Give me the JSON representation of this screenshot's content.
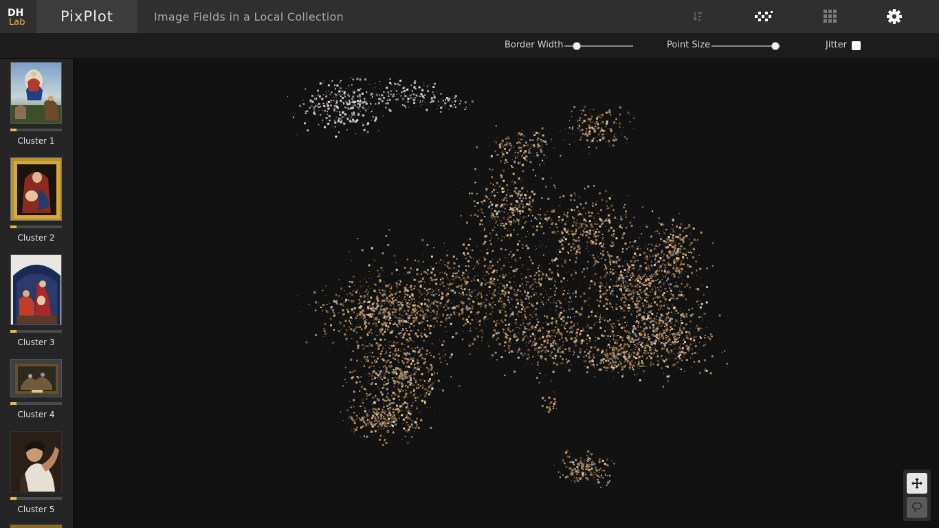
{
  "header": {
    "logo_text": "DH Lab",
    "app_name": "PixPlot",
    "page_title": "Image Fields in a Local Collection",
    "icons": [
      "sort-icon",
      "scatter-layout-icon",
      "grid-layout-icon",
      "settings-gear-icon"
    ]
  },
  "controls": {
    "border_width_label": "Border Width",
    "border_width_value": 0.18,
    "point_size_label": "Point Size",
    "point_size_value": 0.93,
    "jitter_label": "Jitter",
    "jitter_checked": false
  },
  "sidebar": {
    "clusters": [
      {
        "label": "Cluster 1",
        "progress": 0.12
      },
      {
        "label": "Cluster 2",
        "progress": 0.12
      },
      {
        "label": "Cluster 3",
        "progress": 0.12
      },
      {
        "label": "Cluster 4",
        "progress": 0.12
      },
      {
        "label": "Cluster 5",
        "progress": 0.12
      }
    ]
  },
  "tools": {
    "items": [
      "pan-tool-icon",
      "lasso-tool-icon"
    ],
    "active": "pan-tool-icon"
  },
  "colors": {
    "accent": "#e9b742",
    "header_bg": "#2f2f2f",
    "canvas_bg": "#121212"
  }
}
